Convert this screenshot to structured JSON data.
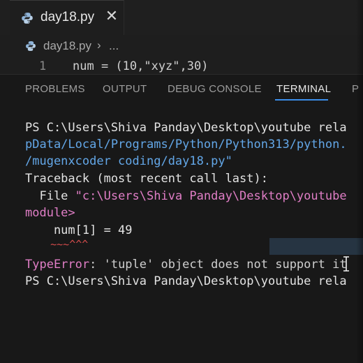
{
  "editor_tab": {
    "file_name": "day18.py",
    "close_glyph": "✕",
    "icon": "python-file-icon"
  },
  "breadcrumb": {
    "file_name": "day18.py",
    "separator": "›",
    "more": "..."
  },
  "editor": {
    "line_number": "1",
    "code": "num = (10,\"xyz\",30)"
  },
  "panel": {
    "tabs": [
      {
        "label": "PROBLEMS"
      },
      {
        "label": "OUTPUT"
      },
      {
        "label": "DEBUG CONSOLE"
      },
      {
        "label": "TERMINAL",
        "active": true
      },
      {
        "label": "P"
      }
    ]
  },
  "terminal": {
    "prompt_1": "PS C:\\Users\\Shiva Panday\\Desktop\\youtube rela",
    "path_line_1": "pData/Local/Programs/Python/Python313/python.",
    "path_line_2": "/mugenxcoder coding/day18.py\"",
    "traceback_header": "Traceback (most recent call last):",
    "file_prefix": "  File ",
    "file_path": "\"c:\\Users\\Shiva Panday\\Desktop\\youtube",
    "module_line": "module>",
    "code_line": "    num[1] = 49",
    "caret_line": "    ~~~^^^",
    "error_type": "TypeError",
    "error_message": ": 'tuple' object does not support it",
    "prompt_2": "PS C:\\Users\\Shiva Panday\\Desktop\\youtube rela"
  },
  "colors": {
    "prompt": "#e3e3e3",
    "path": "#63a7e8",
    "error": "#e07ec6",
    "caret": "#d24b4b",
    "active_tab_underline": "#3b8eea"
  }
}
